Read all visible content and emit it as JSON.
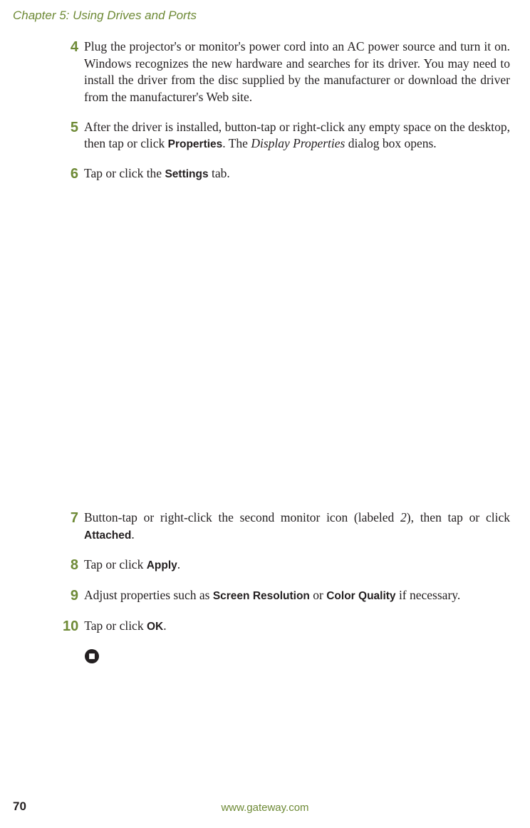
{
  "header": {
    "chapter": "Chapter 5: Using Drives and Ports"
  },
  "steps": {
    "s4": {
      "num": "4",
      "text_a": "Plug the projector's or monitor's power cord into an AC power source and turn it on. Windows recognizes the new hardware and searches for its driver. You may need to install the driver from the disc supplied by the manufacturer or download the driver from the manufacturer's Web site."
    },
    "s5": {
      "num": "5",
      "text_a": "After the driver is installed, button-tap or right-click any empty space on the desktop, then tap or click ",
      "ui_a": "Properties",
      "text_b": ". The ",
      "italic_a": "Display Properties",
      "text_c": " dialog box opens."
    },
    "s6": {
      "num": "6",
      "text_a": "Tap or click the ",
      "ui_a": "Settings",
      "text_b": " tab."
    },
    "s7": {
      "num": "7",
      "text_a": "Button-tap or right-click the second monitor icon (labeled ",
      "italic_a": "2",
      "text_b": "), then tap or click ",
      "ui_a": "Attached",
      "text_c": "."
    },
    "s8": {
      "num": "8",
      "text_a": "Tap or click ",
      "ui_a": "Apply",
      "text_b": "."
    },
    "s9": {
      "num": "9",
      "text_a": "Adjust properties such as ",
      "ui_a": "Screen Resolution",
      "text_b": " or ",
      "ui_b": "Color Quality",
      "text_c": " if necessary."
    },
    "s10": {
      "num": "10",
      "text_a": "Tap or click ",
      "ui_a": "OK",
      "text_b": "."
    }
  },
  "footer": {
    "page_num": "70",
    "url": "www.gateway.com"
  }
}
